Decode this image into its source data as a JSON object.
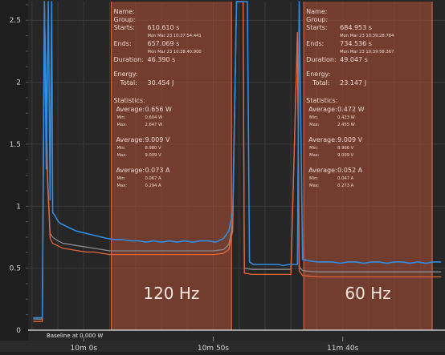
{
  "colors": {
    "background": "#262626",
    "grid": "#3a3a3a",
    "selection_fill": "#a24b33",
    "selection_border": "#d3623f",
    "power_series": "#2f8de4",
    "voltage_series": "#e9663a",
    "current_series": "#8a8a8a",
    "baseline": "#e6e6e6",
    "text": "#d7d7d7"
  },
  "chart_data": {
    "type": "line",
    "y_ticks": [
      "0",
      "0.5",
      "1",
      "1.5",
      "2",
      "2.5"
    ],
    "ylim": [
      0,
      2.65
    ],
    "x_ticks": [
      "10m 0s",
      "10m 50s",
      "11m 40s"
    ],
    "xlim": [
      578.5,
      739.5
    ],
    "x_tick_values": [
      600,
      650,
      700
    ],
    "baseline_label": "Baseline at 0.000 W",
    "grid": true,
    "regions": [
      {
        "start": 610.61,
        "end": 657.069,
        "rate_label": "120 Hz",
        "info": {
          "name_label": "Name:",
          "group_label": "Group:",
          "starts_label": "Starts:",
          "starts_value": "610.610 s",
          "starts_time": "Mon Mar 23 10:37:54:441",
          "ends_label": "Ends:",
          "ends_value": "657.069 s",
          "ends_time": "Mon Mar 23 10:38:40:900",
          "duration_label": "Duration:",
          "duration_value": "46.390 s",
          "energy_label": "Energy:",
          "total_label": "Total:",
          "total_value": "30.454 J",
          "statistics_label": "Statistics:",
          "power_avg_label": "Average:",
          "power_avg": "0.656 W",
          "power_min_label": "Min:",
          "power_min": "0.604 W",
          "power_max_label": "Max:",
          "power_max": "2.647 W",
          "volt_avg_label": "Average:",
          "volt_avg": "9.009 V",
          "volt_min_label": "Min:",
          "volt_min": "8.980 V",
          "volt_max_label": "Max:",
          "volt_max": "9.009 V",
          "curr_avg_label": "Average:",
          "curr_avg": "0.073 A",
          "curr_min_label": "Min:",
          "curr_min": "0.067 A",
          "curr_max_label": "Max:",
          "curr_max": "0.294 A"
        }
      },
      {
        "start": 684.953,
        "end": 734.536,
        "rate_label": "60 Hz",
        "info": {
          "name_label": "Name:",
          "group_label": "Group:",
          "starts_label": "Starts:",
          "starts_value": "684.953 s",
          "starts_time": "Mon Mar 23 10:39:28:784",
          "ends_label": "Ends:",
          "ends_value": "734.536 s",
          "ends_time": "Mon Mar 23 10:39:58:367",
          "duration_label": "Duration:",
          "duration_value": "49.047 s",
          "energy_label": "Energy:",
          "total_label": "Total:",
          "total_value": "23.147 J",
          "statistics_label": "Statistics:",
          "power_avg_label": "Average:",
          "power_avg": "0.472 W",
          "power_min_label": "Min:",
          "power_min": "0.423 W",
          "power_max_label": "Max:",
          "power_max": "2.455 W",
          "volt_avg_label": "Average:",
          "volt_avg": "9.009 V",
          "volt_min_label": "Min:",
          "volt_min": "8.966 V",
          "volt_max_label": "Max:",
          "volt_max": "9.009 V",
          "curr_avg_label": "Average:",
          "curr_avg": "0.052 A",
          "curr_min_label": "Min:",
          "curr_min": "0.047 A",
          "curr_max_label": "Max:",
          "curr_max": "0.273 A"
        }
      }
    ],
    "series": [
      {
        "color": "#2f8de4",
        "x": [
          580.5,
          583,
          584,
          584.8,
          585.5,
          586.3,
          587,
          587.6,
          588,
          589,
          590,
          591,
          593,
          595,
          597,
          599,
          601,
          603,
          605,
          607,
          609,
          612,
          615,
          618,
          621,
          624,
          627,
          630,
          633,
          636,
          639,
          642,
          645,
          648,
          651,
          654,
          656,
          657.5,
          659,
          660.5,
          661.5,
          662.3,
          663.2,
          664,
          665.5,
          667,
          669,
          671,
          673,
          675,
          677,
          679,
          681,
          682.5,
          683.2,
          684.5,
          687,
          690,
          693,
          696,
          699,
          702,
          705,
          708,
          711,
          714,
          717,
          720,
          723,
          726,
          729,
          732,
          735,
          738
        ],
        "y": [
          0.1,
          0.1,
          0.1,
          2.65,
          1.3,
          2.65,
          1.05,
          2.65,
          0.95,
          0.92,
          0.88,
          0.86,
          0.84,
          0.82,
          0.8,
          0.79,
          0.78,
          0.77,
          0.76,
          0.75,
          0.74,
          0.73,
          0.73,
          0.72,
          0.72,
          0.71,
          0.72,
          0.71,
          0.72,
          0.71,
          0.72,
          0.71,
          0.72,
          0.72,
          0.71,
          0.74,
          0.8,
          0.95,
          2.65,
          2.65,
          2.65,
          2.65,
          2.65,
          0.55,
          0.53,
          0.53,
          0.53,
          0.53,
          0.53,
          0.53,
          0.52,
          0.53,
          0.53,
          0.53,
          2.65,
          0.57,
          0.56,
          0.55,
          0.55,
          0.55,
          0.54,
          0.55,
          0.55,
          0.54,
          0.55,
          0.55,
          0.54,
          0.55,
          0.55,
          0.54,
          0.55,
          0.54,
          0.55,
          0.55
        ]
      },
      {
        "color": "#e9663a",
        "x": [
          580.5,
          583,
          584,
          584.8,
          586,
          587,
          588,
          590,
          592,
          595,
          598,
          601,
          604,
          607,
          610,
          615,
          620,
          625,
          630,
          635,
          640,
          645,
          650,
          654,
          656,
          657.5,
          659,
          660.5,
          661.5,
          662,
          665,
          670,
          675,
          680,
          682.5,
          683.2,
          684.5,
          690,
          700,
          710,
          720,
          730,
          738
        ],
        "y": [
          0.07,
          0.07,
          0.07,
          2.65,
          1.2,
          0.74,
          0.7,
          0.68,
          0.66,
          0.65,
          0.64,
          0.63,
          0.63,
          0.62,
          0.61,
          0.61,
          0.61,
          0.61,
          0.61,
          0.61,
          0.61,
          0.61,
          0.61,
          0.62,
          0.65,
          0.8,
          2.65,
          2.65,
          2.65,
          0.46,
          0.45,
          0.45,
          0.45,
          0.45,
          2.4,
          0.48,
          0.44,
          0.43,
          0.43,
          0.43,
          0.43,
          0.43,
          0.43
        ]
      },
      {
        "color": "#8a8a8a",
        "x": [
          580.5,
          583,
          584,
          584.8,
          586,
          587,
          588,
          590,
          592,
          595,
          598,
          601,
          604,
          607,
          610,
          615,
          620,
          625,
          630,
          635,
          640,
          645,
          650,
          654,
          656,
          657.5,
          659,
          660.5,
          661.5,
          662,
          665,
          670,
          675,
          680,
          682.5,
          683.2,
          684.5,
          690,
          700,
          710,
          720,
          730,
          738
        ],
        "y": [
          0.09,
          0.09,
          0.09,
          2.65,
          1.25,
          0.78,
          0.75,
          0.72,
          0.7,
          0.69,
          0.68,
          0.67,
          0.66,
          0.65,
          0.64,
          0.64,
          0.64,
          0.64,
          0.64,
          0.64,
          0.64,
          0.64,
          0.64,
          0.65,
          0.69,
          0.85,
          2.65,
          2.65,
          2.65,
          0.5,
          0.49,
          0.49,
          0.49,
          0.49,
          2.4,
          0.51,
          0.48,
          0.47,
          0.47,
          0.47,
          0.47,
          0.47,
          0.47
        ]
      }
    ]
  }
}
